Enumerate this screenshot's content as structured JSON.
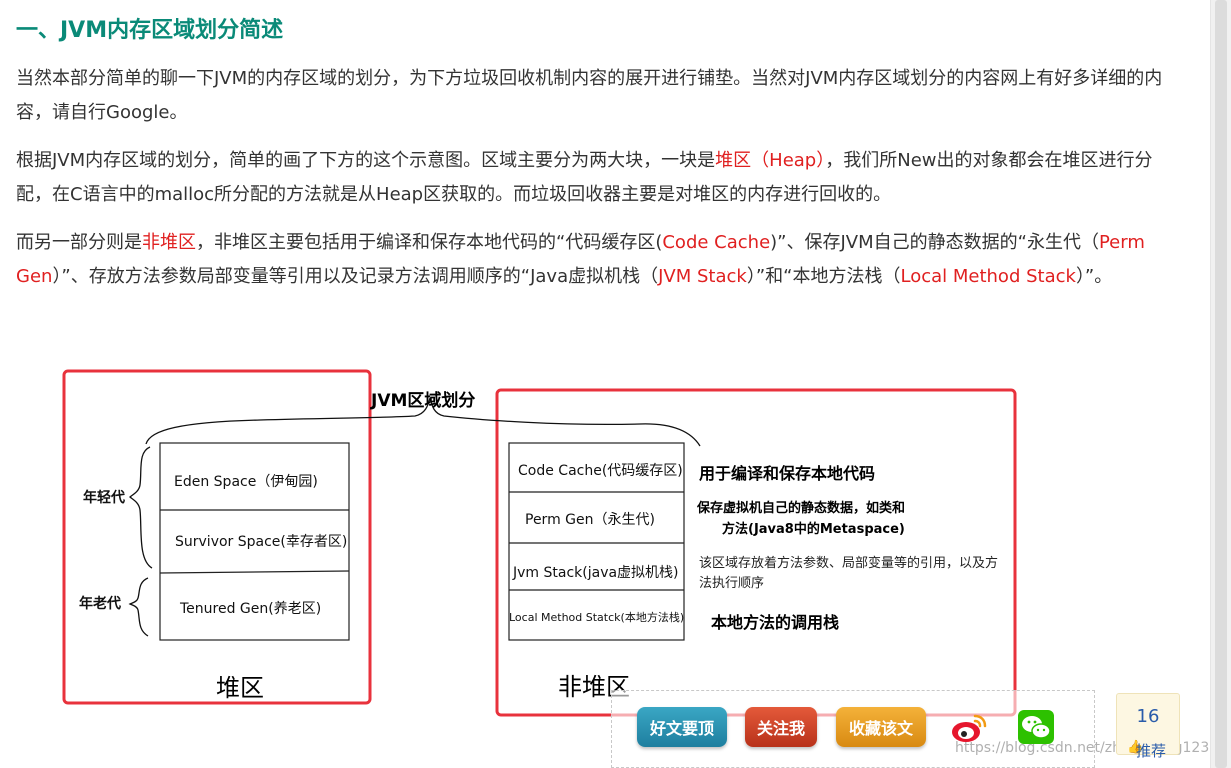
{
  "article": {
    "title": "一、JVM内存区域划分简述",
    "p1": "当然本部分简单的聊一下JVM的内存区域的划分，为下方垃圾回收机制内容的展开进行铺垫。当然对JVM内存区域划分的内容网上有好多详细的内容，请自行Google。",
    "p2": {
      "before": "根据JVM内存区域的划分，简单的画了下方的这个示意图。区域主要分为两大块，一块是",
      "heap": "堆区（Heap）",
      "after": "，我们所New出的对象都会在堆区进行分配，在C语言中的malloc所分配的方法就是从Heap区获取的。而垃圾回收器主要是对堆区的内存进行回收的。"
    },
    "p3": {
      "t1": "而另一部分则是",
      "nonheap": "非堆区",
      "t2": "，非堆区主要包括用于编译和保存本地代码的“代码缓存区(",
      "code_cache": "Code Cache",
      "t3": ")”、保存JVM自己的静态数据的“永生代（",
      "perm_gen": "Perm Gen",
      "t4": "）”、存放方法参数局部变量等引用以及记录方法调用顺序的“Java虚拟机栈（",
      "jvm_stack": "JVM Stack",
      "t5": "）”和“本地方法栈（",
      "native_stack": "Local Method Stack",
      "t6": "）”。"
    }
  },
  "diagram": {
    "title": "JVM区域划分",
    "heap_cells": [
      "Eden Space（伊甸园)",
      "Survivor Space(幸存者区)",
      "Tenured Gen(养老区)"
    ],
    "young_label": "年轻代",
    "old_label": "年老代",
    "heap_label": "堆区",
    "nonheap_cells": [
      "Code Cache(代码缓存区)",
      "Perm Gen（永生代)",
      "Jvm Stack(java虚拟机栈)",
      "Local Method Statck(本地方法栈)"
    ],
    "nonheap_label": "非堆区",
    "annotations": {
      "code_cache": "用于编译和保存本地代码",
      "perm_gen_line1": "保存虚拟机自己的静态数据，如类和",
      "perm_gen_line2": "方法(Java8中的Metaspace)",
      "jvm_stack": "该区域存放着方法参数、局部变量等的引用，以及方法执行顺序",
      "native_stack": "本地方法的调用栈"
    },
    "highlight_color": "#e8323c"
  },
  "share": {
    "good_label": "好文要顶",
    "follow_label": "关注我",
    "favorite_label": "收藏该文",
    "weibo_icon": "weibo-icon",
    "wechat_icon": "wechat-icon",
    "watermark": "https://blog.csdn.net/zhangdong123"
  },
  "recommend": {
    "count": "16",
    "label": "推荐"
  }
}
